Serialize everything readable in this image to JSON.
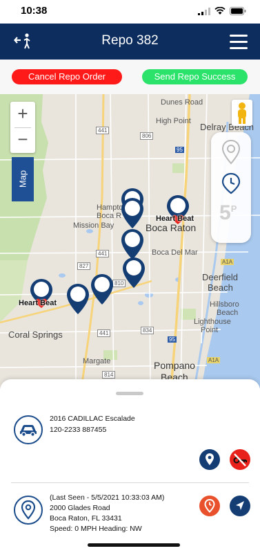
{
  "status_bar": {
    "time": "10:38"
  },
  "nav": {
    "title": "Repo 382"
  },
  "actions": {
    "cancel_label": "Cancel Repo Order",
    "success_label": "Send Repo Success"
  },
  "map": {
    "toggle_label": "Map",
    "zoom_in": "+",
    "zoom_out": "−",
    "side_badge": "5",
    "side_badge_sup": "P",
    "labels": {
      "dunes_road": "Dunes Road",
      "high_point": "High Point",
      "delray": "Delray Beach",
      "hampton": "Hampton",
      "boca_r": "Boca R",
      "mission_bay": "Mission Bay",
      "boca_raton": "Boca Raton",
      "boca_del_mar": "Boca Del Mar",
      "deerfield": "Deerfield",
      "deerfield_beach": "Beach",
      "hillsboro": "Hillsboro",
      "hillsboro_beach": "Beach",
      "lighthouse": "Lighthouse",
      "lighthouse_point": "Point",
      "coral_springs": "Coral Springs",
      "margate": "Margate",
      "pompano": "Pompano",
      "pompano_beach": "Beach",
      "shield_441a": "441",
      "shield_806": "806",
      "shield_95a": "95",
      "shield_441b": "441",
      "shield_827": "827",
      "shield_810": "810",
      "shield_834": "834",
      "shield_95b": "95",
      "shield_814": "814",
      "shield_a1a1": "A1A",
      "shield_a1a2": "A1A",
      "shield_441c": "441"
    },
    "heartbeat_label_1": "Heart Beat",
    "heartbeat_label_2": "Heart Beat"
  },
  "vehicle": {
    "name": "2016 CADILLAC Escalade",
    "plate": "120-2233 887455"
  },
  "last_seen": {
    "line1": "(Last Seen - 5/5/2021 10:33:03 AM)",
    "line2": "2000 Glades Road",
    "line3": "Boca Raton, FL 33431",
    "line4": "Speed: 0 MPH  Heading: NW"
  },
  "colors": {
    "navbar": "#0d2d5e",
    "cancel": "#ff1a1a",
    "success": "#2be36b",
    "pin": "#143d73",
    "orange": "#e8512b",
    "red": "#e8221b"
  }
}
